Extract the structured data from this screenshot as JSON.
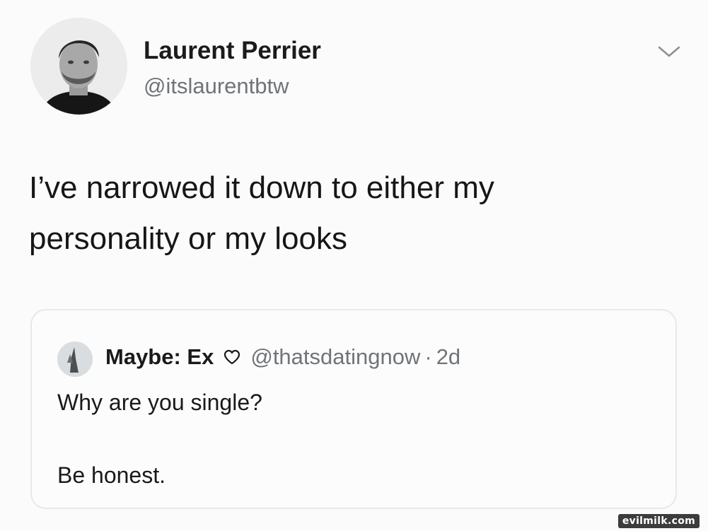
{
  "tweet": {
    "author_name": "Laurent Perrier",
    "author_handle": "@itslaurentbtw",
    "text_lines": [
      "I’ve narrowed it down to either my",
      "personality or my looks"
    ],
    "menu_icon": "chevron-down-icon",
    "avatar_icon": "profile-photo"
  },
  "quoted_tweet": {
    "author_name": "Maybe: Ex",
    "author_icon": "heart-outline-icon",
    "author_handle": "@thatsdatingnow",
    "separator": "·",
    "time": "2d",
    "line1": "Why are you single?",
    "line2": "Be honest."
  },
  "watermark": "evilmilk.com",
  "colors": {
    "text_primary": "#1a1a1a",
    "text_secondary": "#6f7479",
    "border": "#e6e8ea",
    "background": "#fbfbfb"
  }
}
